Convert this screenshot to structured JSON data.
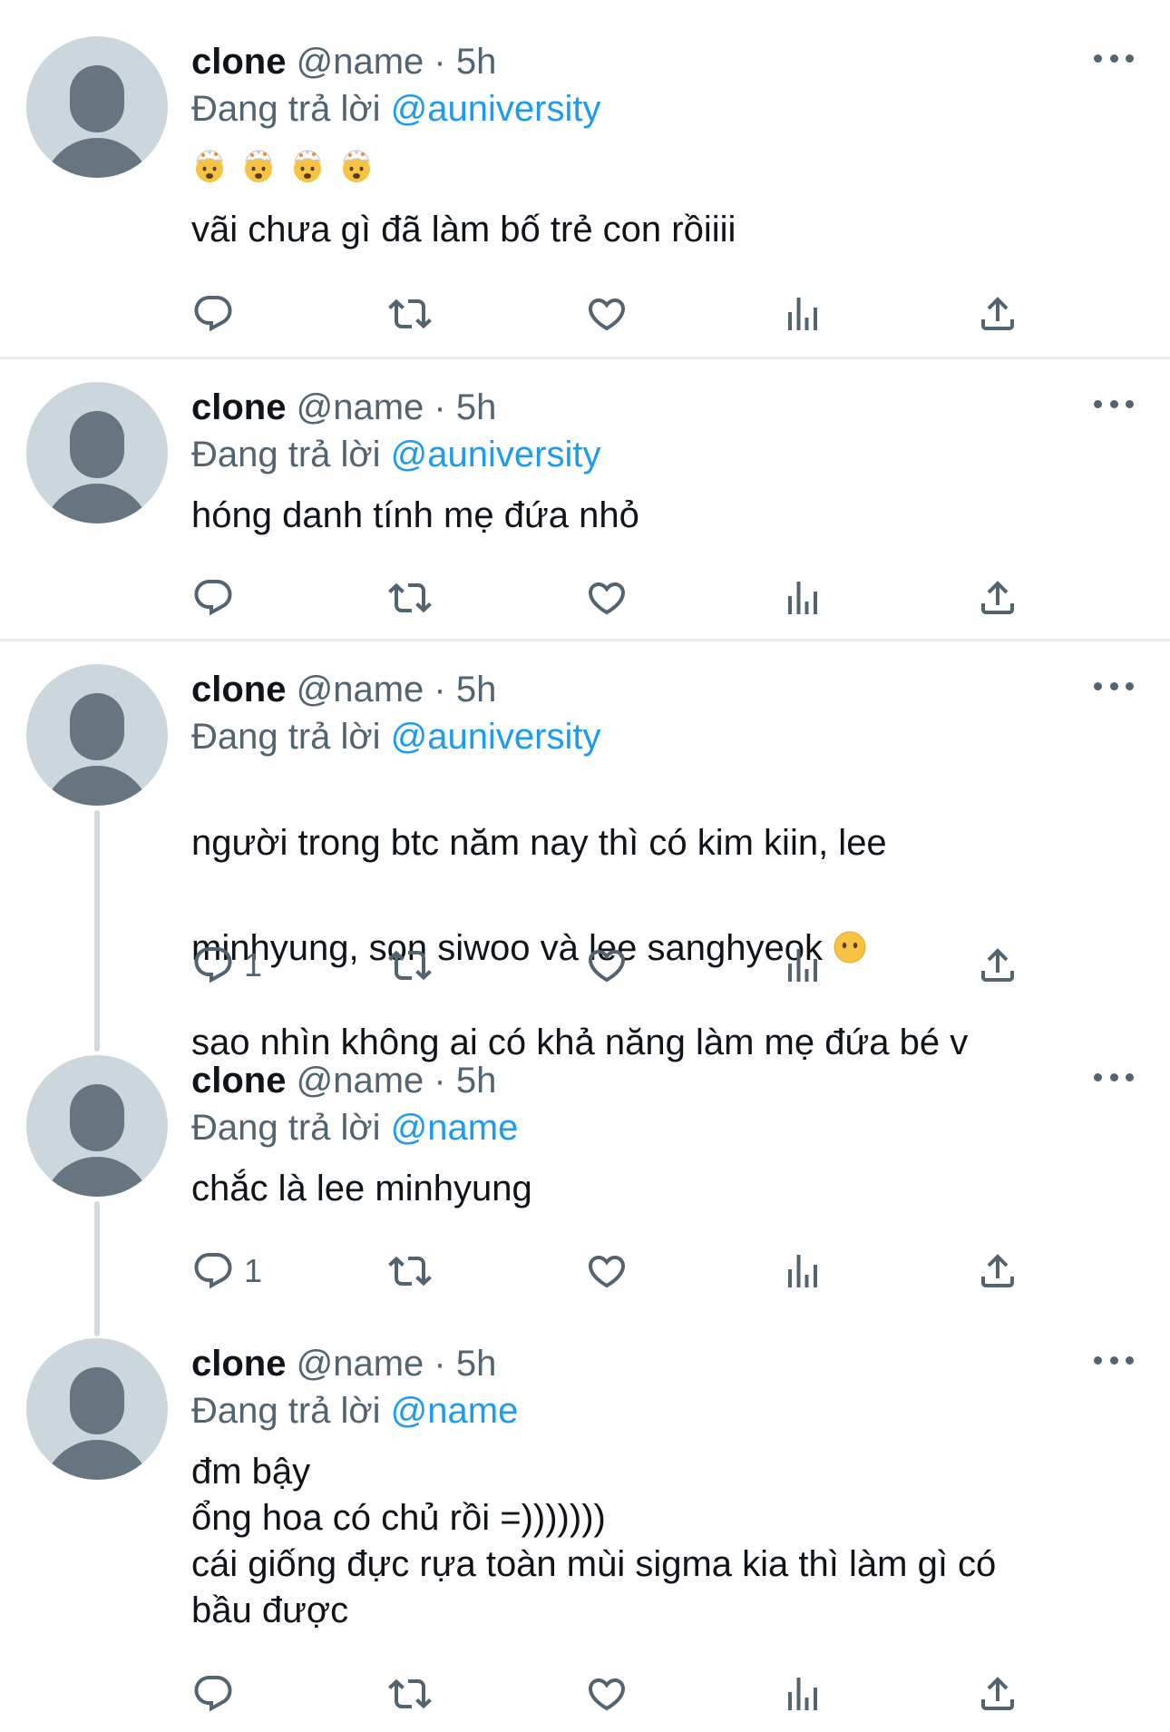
{
  "colors": {
    "text": "#0f1419",
    "secondary": "#536471",
    "mention": "#1d9bf0",
    "avatar_bg": "#ccd6dd",
    "avatar_fg": "#66757f",
    "divider": "#e6ecf0"
  },
  "icons": {
    "reply": "reply-icon",
    "retweet": "retweet-icon",
    "like": "heart-icon",
    "views": "analytics-icon",
    "share": "share-icon",
    "more": "more-icon"
  },
  "tweets": [
    {
      "name": "clone",
      "handle": "@name",
      "sep": "·",
      "time": "5h",
      "reply_prefix": "Đang trả lời",
      "reply_to": "@auniversity",
      "text": "vãi chưa gì đã làm bố trẻ con rồiiii",
      "emojis": [
        "exploding-head-emoji",
        "exploding-head-emoji",
        "exploding-head-emoji",
        "exploding-head-emoji"
      ]
    },
    {
      "name": "clone",
      "handle": "@name",
      "sep": "·",
      "time": "5h",
      "reply_prefix": "Đang trả lời",
      "reply_to": "@auniversity",
      "text": "hóng danh tính mẹ đứa nhỏ"
    },
    {
      "name": "clone",
      "handle": "@name",
      "sep": "·",
      "time": "5h",
      "reply_prefix": "Đang trả lời",
      "reply_to": "@auniversity",
      "text_line1": "người trong btc năm nay thì có kim kiin, lee",
      "text_line2": "minhyung, son siwoo và lee sanghyeok",
      "text_line2_emoji": "no-mouth-face-emoji",
      "text_line3": "sao nhìn không ai có khả năng làm mẹ đứa bé v",
      "reply_count": "1"
    },
    {
      "name": "clone",
      "handle": "@name",
      "sep": "·",
      "time": "5h",
      "reply_prefix": "Đang trả lời",
      "reply_to": "@name",
      "text": "chắc là lee minhyung",
      "reply_count": "1"
    },
    {
      "name": "clone",
      "handle": "@name",
      "sep": "·",
      "time": "5h",
      "reply_prefix": "Đang trả lời",
      "reply_to": "@name",
      "text": "đm bậy\nổng hoa có chủ rồi =)))))))\ncái giống đực rựa toàn mùi sigma kia thì làm gì có\nbầu được"
    }
  ]
}
